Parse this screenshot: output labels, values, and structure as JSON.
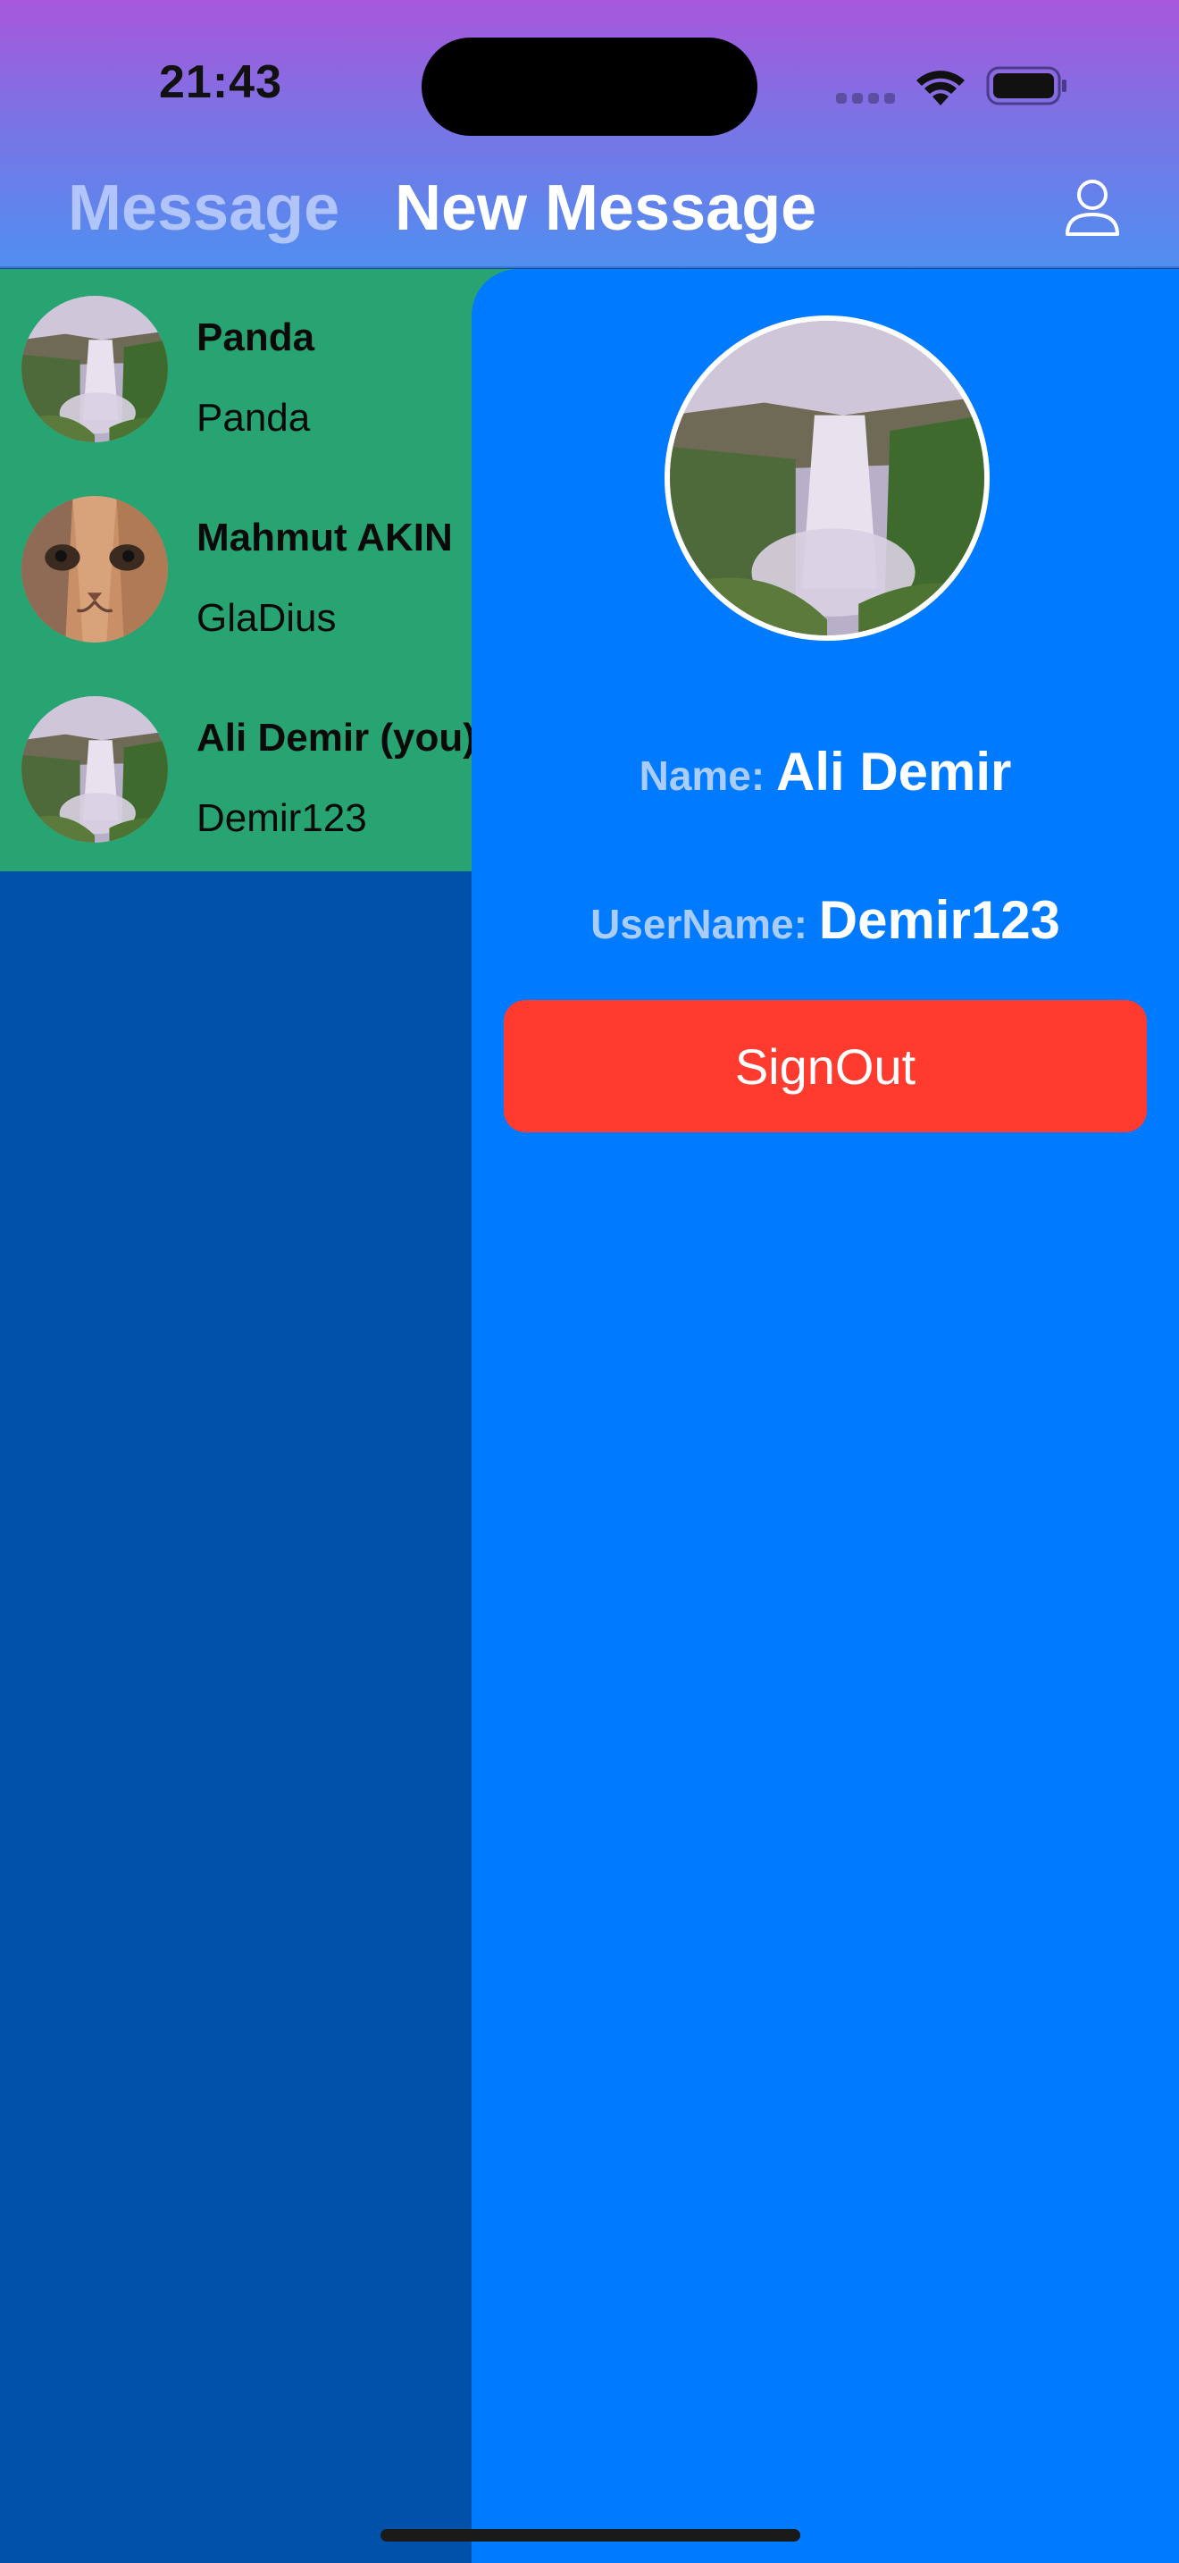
{
  "status_bar": {
    "time": "21:43"
  },
  "header": {
    "tab_message": "Message",
    "tab_new_message": "New Message",
    "profile_icon": "person-icon"
  },
  "contacts": [
    {
      "name": "Panda",
      "username": "Panda",
      "avatar": "waterfall"
    },
    {
      "name": "Mahmut AKIN",
      "username": "GlaDius",
      "avatar": "cat"
    },
    {
      "name": "Ali Demir (you)",
      "username": "Demir123",
      "avatar": "waterfall"
    }
  ],
  "profile": {
    "avatar": "waterfall",
    "name_label": "Name:",
    "name_value": "Ali Demir",
    "username_label": "UserName:",
    "username_value": "Demir123",
    "signout_label": "SignOut"
  },
  "colors": {
    "header_gradient_top": "#a857db",
    "header_gradient_bottom": "#4f8ff0",
    "contact_list_bg": "#27a472",
    "profile_panel_bg": "#007aff",
    "background": "#0052a8",
    "signout_button": "#ff3b30"
  }
}
